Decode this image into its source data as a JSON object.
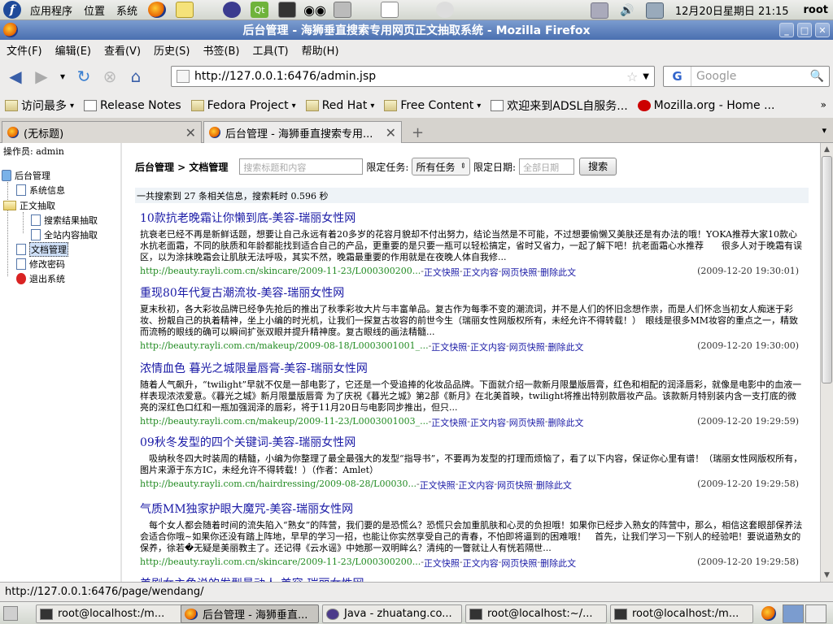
{
  "top_panel": {
    "menus": [
      "应用程序",
      "位置",
      "系统"
    ],
    "clock": "12月20日星期日 21:15",
    "user": "root"
  },
  "window": {
    "title": "后台管理 - 海狮垂直搜索专用网页正文抽取系统 - Mozilla Firefox"
  },
  "menu_bar": [
    "文件(F)",
    "编辑(E)",
    "查看(V)",
    "历史(S)",
    "书签(B)",
    "工具(T)",
    "帮助(H)"
  ],
  "nav": {
    "url": "http://127.0.0.1:6476/admin.jsp",
    "search_placeholder": "Google",
    "search_engine": "G"
  },
  "bookmarks": [
    {
      "label": "访问最多",
      "type": "folder",
      "caret": "▾"
    },
    {
      "label": "Release Notes",
      "type": "page"
    },
    {
      "label": "Fedora Project",
      "type": "folder",
      "caret": "▾"
    },
    {
      "label": "Red Hat",
      "type": "folder",
      "caret": "▾"
    },
    {
      "label": "Free Content",
      "type": "folder",
      "caret": "▾"
    },
    {
      "label": "欢迎来到ADSL自服务...",
      "type": "page"
    },
    {
      "label": "Mozilla.org - Home ...",
      "type": "red"
    }
  ],
  "bookmarks_more": "»",
  "tabs": [
    {
      "title": "(无标题)"
    },
    {
      "title": "后台管理 - 海狮垂直搜索专用..."
    }
  ],
  "new_tab": "+",
  "tab_list": "▾",
  "left_frame": {
    "operator": "操作员: admin",
    "tree": {
      "root": "后台管理",
      "doc_info": "系统信息",
      "extract_folder": "正文抽取",
      "search_extract": "搜索结果抽取",
      "site_extract": "全站内容抽取",
      "doc_manage": "文档管理",
      "change_pwd": "修改密码",
      "logout": "退出系统"
    }
  },
  "search_form": {
    "breadcrumb": "后台管理 > 文档管理",
    "keyword_placeholder": "搜索标题和内容",
    "task_label": "限定任务:",
    "task_value": "所有任务",
    "date_label": "限定日期:",
    "date_placeholder": "全部日期",
    "search_button": "搜索"
  },
  "summary": "一共搜索到 27 条相关信息，搜索耗时 0.596 秒",
  "link_labels": {
    "snapshot": "正文快照",
    "content": "正文内容",
    "page_snapshot": "网页快照",
    "delete": "删除此文"
  },
  "results": [
    {
      "title": "10款抗老晚霜让你懒到底-美容-瑞丽女性网",
      "snippet": "抗衰老已经不再是新鲜话题，想要让自己永远有着20多岁的花容月貌却不付出努力，结论当然是不可能，不过想要偷懒又美肤还是有办法的哦！YOKA推荐大家10款心水抗老面霜，不同的肤质和年龄都能找到适合自己的产品，更重要的是只要一瓶可以轻松搞定，省时又省力，一起了解下吧！抗老面霜心水推荐　　很多人对于晚霜有误区，以为涂抹晚霜会让肌肤无法呼吸，其实不然，晚霜最重要的作用就是在夜晚人体自我修...",
      "url": "http://beauty.rayli.com.cn/skincare/2009-11-23/L000300200...",
      "date": "(2009-12-20 19:30:01)"
    },
    {
      "title": "重现80年代复古潮流妆-美容-瑞丽女性网",
      "snippet": "夏末秋初，各大彩妆品牌已经争先抢后的推出了秋季彩妆大片与丰富单品。复古作为每季不变的潮流词，并不是人们的怀旧念想作祟，而是人们怀念当初女人痴迷于彩妆、扮靓自己的执着精神，坐上小编的时光机，让我们一探复古妆容的前世今生（瑞丽女性网版权所有，未经允许不得转载！）　眼线是很多MM妆容的重点之一，精致而流畅的眼线的确可以瞬间扩张双眼并提升精神度。复古眼线的画法精髓...",
      "url": "http://beauty.rayli.com.cn/makeup/2009-08-18/L0003001001_...",
      "date": "(2009-12-20 19:30:00)"
    },
    {
      "title": "浓情血色 暮光之城限量唇膏-美容-瑞丽女性网",
      "snippet": "随着人气飙升，“twilight”早就不仅是一部电影了，它还是一个受追捧的化妆品品牌。下面就介绍一款新月限量版唇膏，红色和相配的润泽唇彩，就像是电影中的血液一样表现浓浓爱意。《暮光之城》新月限量版唇膏 为了庆祝《暮光之城》第2部《新月》在北美首映，twilight将推出特别款唇妆产品。该款新月特别装内含一支打底的微亮的深红色口红和一瓶加强润泽的唇彩，将于11月20日与电影同步推出，但只...",
      "url": "http://beauty.rayli.com.cn/makeup/2009-11-23/L0003001003_...",
      "date": "(2009-12-20 19:29:59)"
    },
    {
      "title": "09秋冬发型的四个关键词-美容-瑞丽女性网",
      "snippet": "　吸纳秋冬四大时装周的精髓，小编为你整理了最全最强大的发型“指导书”，不要再为发型的打理而烦恼了，看了以下内容，保证你心里有谱！（瑞丽女性网版权所有，图片来源于东方IC，未经允许不得转载！）（作者：Amlet）",
      "url": "http://beauty.rayli.com.cn/hairdressing/2009-08-28/L00030...",
      "date": "(2009-12-20 19:29:58)"
    },
    {
      "title": "气质MM独家护眼大魔咒-美容-瑞丽女性网",
      "snippet": "　每个女人都会随着时间的流失陷入“熟女”的阵营，我们要的是恐慌么？恐慌只会加重肌肤和心灵的负担哦！如果你已经步入熟女的阵营中，那么，相信这套眼部保养法会适合你哦~如果你还没有踏上阵地，早早的学习一招，也能让你实然享受自己的青春，不怕即将逼到的困难哦！　首先，让我们学习一下别人的经验吧！要说道熟女的保养，徐若�无疑是美丽教主了。还记得《云水谣》中她那一双明眸么？清纯的一瞥就让人有恍若隔世...",
      "url": "http://beauty.rayli.com.cn/skincare/2009-11-23/L000300200...",
      "date": "(2009-12-20 19:29:58)"
    },
    {
      "title": "美剧女主角说的发型最动人-美容-瑞丽女性网",
      "snippet": "",
      "url": "",
      "date": ""
    }
  ],
  "status_bar": "http://127.0.0.1:6476/page/wendang/",
  "taskbar": [
    {
      "label": "root@localhost:/m...",
      "icon": "terminal"
    },
    {
      "label": "后台管理 - 海狮垂直...",
      "icon": "firefox",
      "active": true
    },
    {
      "label": "Java - zhuatang.co...",
      "icon": "java"
    },
    {
      "label": "root@localhost:~/...",
      "icon": "terminal"
    },
    {
      "label": "root@localhost:/m...",
      "icon": "terminal"
    }
  ],
  "colors": {
    "title_bar": "#4a6fb0",
    "link": "#1a1aa6",
    "url_green": "#228b22",
    "summary_bg": "#eef3f7"
  }
}
